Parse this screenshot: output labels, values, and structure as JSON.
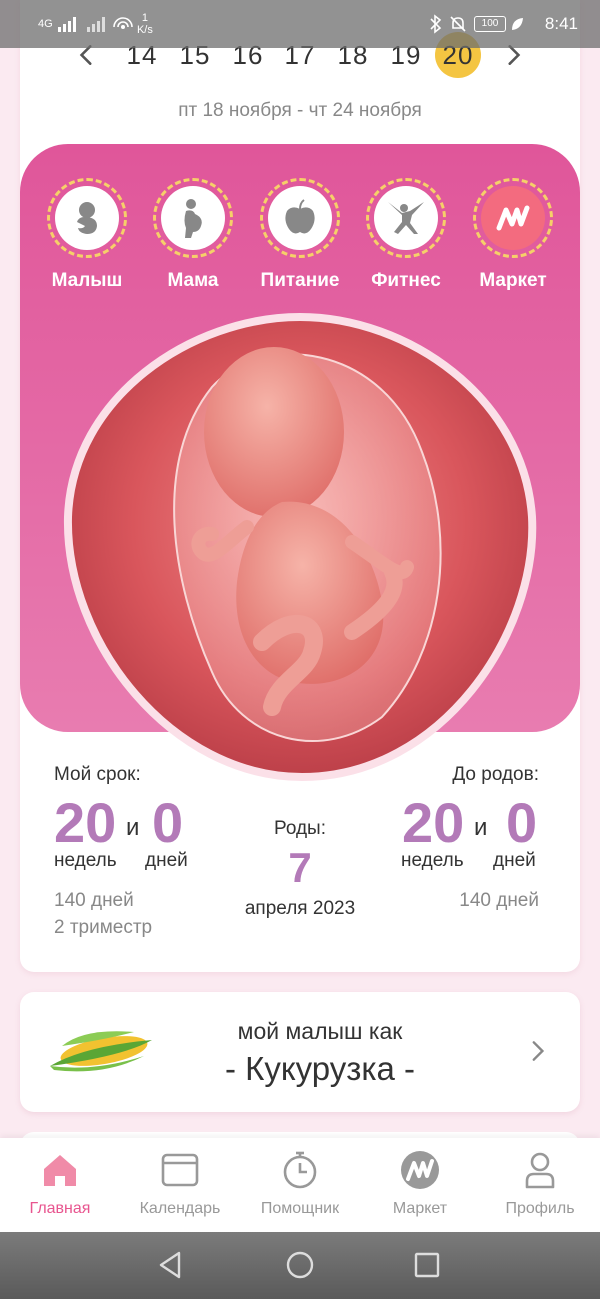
{
  "status_bar": {
    "network": "4G",
    "speed_value": "1",
    "speed_unit": "K/s",
    "battery": "100",
    "time": "8:41"
  },
  "week_selector": {
    "weeks": [
      "14",
      "15",
      "16",
      "17",
      "18",
      "19",
      "20"
    ],
    "selected": "20",
    "range": "пт 18 ноября - чт 24 ноября"
  },
  "categories": [
    {
      "label": "Малыш",
      "icon": "baby-icon"
    },
    {
      "label": "Мама",
      "icon": "pregnant-mother-icon"
    },
    {
      "label": "Питание",
      "icon": "apple-icon"
    },
    {
      "label": "Фитнес",
      "icon": "yoga-pose-icon"
    },
    {
      "label": "Маркет",
      "icon": "market-logo-icon"
    }
  ],
  "colors": {
    "accent_pink": "#e0569a",
    "number_purple": "#b37ab8",
    "highlight_yellow": "#f4c542",
    "nav_active": "#e8558f"
  },
  "stats": {
    "my_term_label": "Мой срок:",
    "my_weeks": "20",
    "my_days": "0",
    "conj": "и",
    "weeks_unit": "недель",
    "days_unit": "дней",
    "days_total": "140 дней",
    "trimester": "2 триместр",
    "birth_label": "Роды:",
    "birth_day": "7",
    "birth_month_year": "апреля 2023",
    "until_label": "До родов:",
    "until_weeks": "20",
    "until_days": "0",
    "until_days_total": "140 дней"
  },
  "baby_size": {
    "subtitle": "мой малыш как",
    "fruit": "- Кукурузка -",
    "icon": "corn-icon"
  },
  "bottom_nav": [
    {
      "label": "Главная",
      "icon": "home-icon",
      "active": true
    },
    {
      "label": "Календарь",
      "icon": "calendar-icon"
    },
    {
      "label": "Помощник",
      "icon": "stopwatch-icon"
    },
    {
      "label": "Маркет",
      "icon": "market-icon"
    },
    {
      "label": "Профиль",
      "icon": "profile-icon"
    }
  ]
}
